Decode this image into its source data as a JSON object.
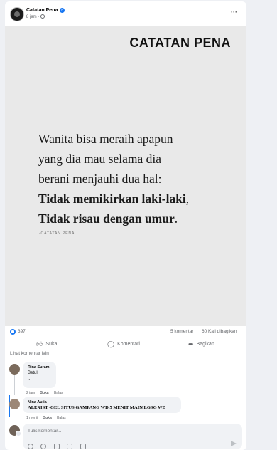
{
  "post": {
    "page_name": "Catatan Pena",
    "meta_time": "8 jam ·",
    "image": {
      "brand": "CATATAN PENA",
      "quote_lines": [
        "Wanita bisa meraih apapun",
        "yang dia mau selama dia",
        "berani menjauhi dua hal:"
      ],
      "quote_bold_1": "Tidak memikirkan laki-laki",
      "quote_bold_1_tail": ",",
      "quote_bold_2": "Tidak risau dengan umur",
      "quote_bold_2_tail": ".",
      "signature": "-CATATAN PENA"
    },
    "stats": {
      "likes": "397",
      "comments": "5 komentar",
      "shares": "60 Kali dibagikan"
    },
    "actions": {
      "like": "Suka",
      "comment": "Komentari",
      "share": "Bagikan"
    }
  },
  "comments": {
    "more_label": "Lihat komentar lain",
    "items": [
      {
        "name": "Rina Surami",
        "lines": [
          "Betul",
          ".."
        ],
        "time": "2 jam",
        "like": "Suka",
        "reply": "Balas"
      },
      {
        "name": "Nina Aulia",
        "text": "ALEXIST~GEL SITUS GAMPANG WD 5 MENIT MAIN LGSG WD",
        "time": "1 menit",
        "like": "Suka",
        "reply": "Balas"
      }
    ]
  },
  "composer": {
    "placeholder": "Tulis komentar..."
  },
  "colors": {
    "accent": "#1877f2",
    "image_bg": "#e9e9e9",
    "page_bg": "#eef0f4"
  }
}
